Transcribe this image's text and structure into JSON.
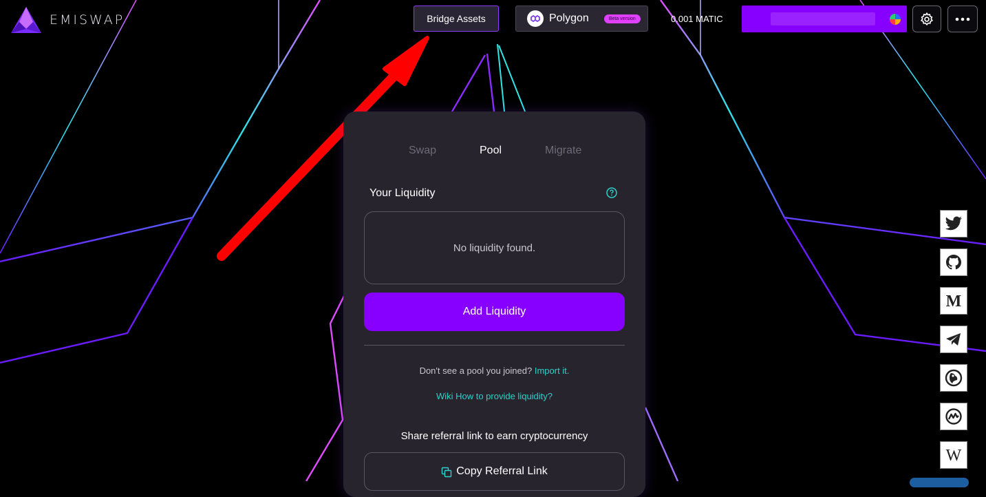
{
  "header": {
    "brand": "EMISWAP",
    "bridge_label": "Bridge Assets",
    "network_label": "Polygon",
    "network_badge": "Beta version",
    "balance": "0.001 MATIC",
    "icons": [
      "settings-gear-icon",
      "more-dots-icon"
    ]
  },
  "tabs": [
    {
      "label": "Swap"
    },
    {
      "label": "Pool"
    },
    {
      "label": "Migrate"
    }
  ],
  "pool": {
    "title": "Your Liquidity",
    "empty_text": "No liquidity found.",
    "add_label": "Add Liquidity",
    "joined_text": "Don't see a pool you joined?",
    "import_link": "Import it.",
    "wiki_link": "Wiki How to provide liquidity?",
    "share_text": "Share referral link to earn cryptocurrency",
    "copy_label": "Copy Referral Link"
  },
  "social": [
    "twitter-icon",
    "github-icon",
    "medium-icon",
    "telegram-icon",
    "coingecko-icon",
    "coinmarketcap-icon",
    "wikipedia-icon"
  ],
  "colors": {
    "accent": "#8700ff",
    "link": "#29d3c9",
    "card": "#27242e",
    "arrow": "#ff0000"
  }
}
